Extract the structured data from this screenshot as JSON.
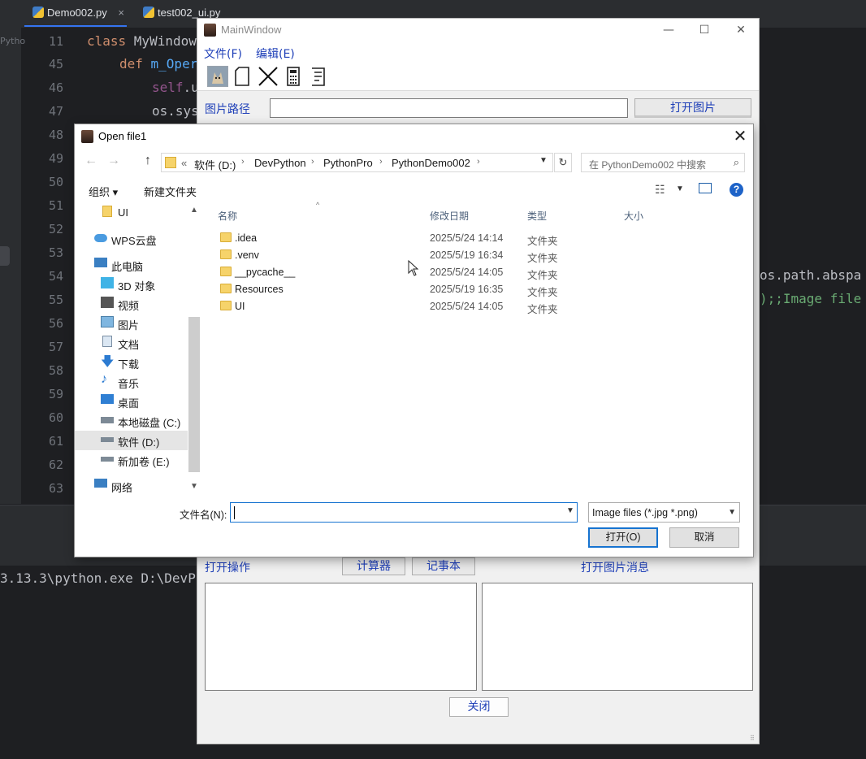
{
  "ide": {
    "tabs": [
      {
        "label": "Demo002.py",
        "close": "×"
      },
      {
        "label": "test002_ui.py"
      }
    ],
    "side_label": "Pytho",
    "line_numbers": [
      "11",
      "45",
      "46",
      "47",
      "48",
      "49",
      "50",
      "51",
      "52",
      "53",
      "54",
      "55",
      "56",
      "57",
      "58",
      "59",
      "60",
      "61",
      "62",
      "63"
    ],
    "code": {
      "l11_kw": "class ",
      "l11_name": "MyWindow",
      "l45_kw": "def ",
      "l45_name": "m_Oper",
      "l46_self": "self",
      "l46_rest": ".u",
      "l47": "os.sys",
      "right1": "os.path.abspa",
      "right2": ");;Image file"
    },
    "terminal": "3.13.3\\python.exe D:\\DevP"
  },
  "mainwindow": {
    "title": "MainWindow",
    "controls": {
      "minimize": "—",
      "maximize": "☐",
      "close": "✕"
    },
    "menu": [
      "文件(F)",
      "编辑(E)"
    ],
    "toolbar_icons": [
      "image-icon",
      "page-icon",
      "close-icon",
      "calculator-icon",
      "notepad-icon"
    ],
    "path_label": "图片路径",
    "path_value": "",
    "open_image_button": "打开图片",
    "open_ops_label": "打开操作",
    "calculator_button": "计算器",
    "notepad_button": "记事本",
    "open_image_msg_label": "打开图片消息",
    "close_button": "关闭"
  },
  "dialog": {
    "title": "Open file1",
    "close": "✕",
    "nav": {
      "back": "←",
      "forward": "→",
      "up": "↑"
    },
    "breadcrumb": [
      "«",
      "软件 (D:)",
      "DevPython",
      "PythonPro",
      "PythonDemo002"
    ],
    "refresh": "↻",
    "search_placeholder": "在 PythonDemo002 中搜索",
    "search_icon": "⌕",
    "organize": "组织 ▾",
    "new_folder": "新建文件夹",
    "help": "?",
    "nav_items": [
      {
        "label": "UI",
        "icon": "folder-icon"
      },
      {
        "label": "WPS云盘",
        "icon": "cloud-icon"
      },
      {
        "label": "此电脑",
        "icon": "computer-icon"
      },
      {
        "label": "3D 对象",
        "icon": "cube-icon"
      },
      {
        "label": "视频",
        "icon": "video-icon"
      },
      {
        "label": "图片",
        "icon": "picture-icon"
      },
      {
        "label": "文档",
        "icon": "document-icon"
      },
      {
        "label": "下载",
        "icon": "download-icon"
      },
      {
        "label": "音乐",
        "icon": "music-icon"
      },
      {
        "label": "桌面",
        "icon": "desktop-icon"
      },
      {
        "label": "本地磁盘 (C:)",
        "icon": "drive-icon"
      },
      {
        "label": "软件 (D:)",
        "icon": "drive-icon"
      },
      {
        "label": "新加卷 (E:)",
        "icon": "drive-icon"
      },
      {
        "label": "网络",
        "icon": "network-icon"
      }
    ],
    "columns": [
      "名称",
      "修改日期",
      "类型",
      "大小"
    ],
    "files": [
      {
        "name": ".idea",
        "date": "2025/5/24 14:14",
        "type": "文件夹"
      },
      {
        "name": ".venv",
        "date": "2025/5/19 16:34",
        "type": "文件夹"
      },
      {
        "name": "__pycache__",
        "date": "2025/5/24 14:05",
        "type": "文件夹"
      },
      {
        "name": "Resources",
        "date": "2025/5/19 16:35",
        "type": "文件夹"
      },
      {
        "name": "UI",
        "date": "2025/5/24 14:05",
        "type": "文件夹"
      }
    ],
    "filename_label": "文件名(N):",
    "filename_value": "",
    "filter": "Image files (*.jpg *.png)",
    "open_button": "打开(O)",
    "cancel_button": "取消"
  }
}
